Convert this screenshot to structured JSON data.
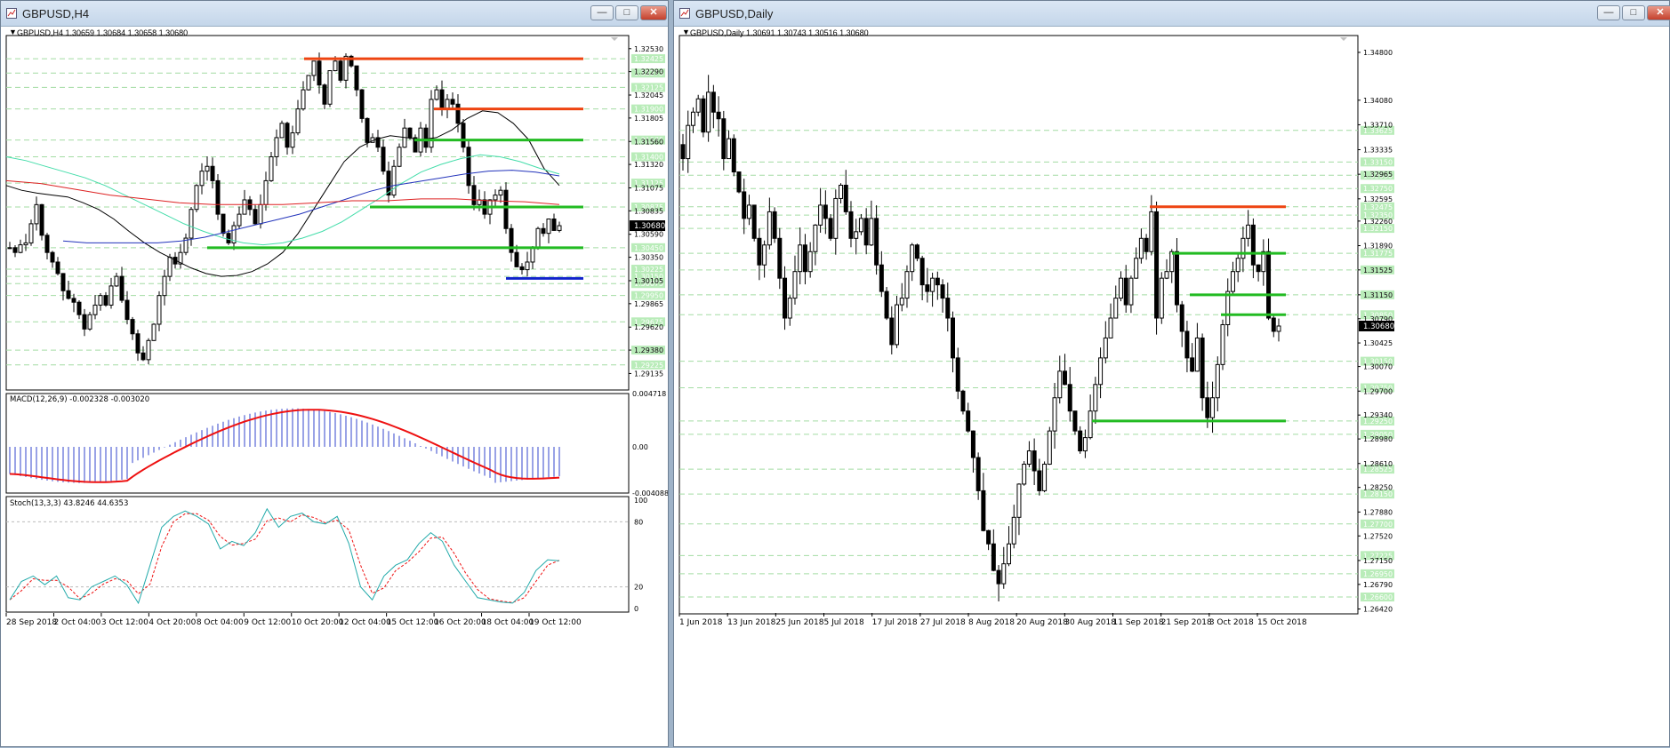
{
  "windows": {
    "h4": {
      "title": "GBPUSD,H4",
      "header": "GBPUSD,H4  1.30659 1.30684 1.30658 1.30680"
    },
    "daily": {
      "title": "GBPUSD,Daily",
      "header": "GBPUSD,Daily  1.30691 1.30743 1.30516 1.30680"
    }
  },
  "window_buttons": {
    "minimize": "—",
    "restore": "□",
    "close": "✕"
  },
  "colors": {
    "bull": "#ffffff",
    "bear": "#000000",
    "support": "#22bb22",
    "resistance": "#ee4411",
    "blue_line": "#1122cc",
    "grid": "#a3dca3",
    "price_box": "#000000",
    "macd_hist": "#3344cc",
    "macd_signal": "#ee1111",
    "stoch_main": "#22aaaa",
    "stoch_signal": "#ee1111",
    "ma_black": "#000000",
    "ma_green": "#44ddaa",
    "ma_blue": "#2233bb",
    "ma_red": "#dd2222"
  },
  "chart_data": [
    {
      "type": "candlestick",
      "title": "GBPUSD,H4",
      "ohlc_readout": [
        1.30659,
        1.30684,
        1.30658,
        1.3068
      ],
      "ylim": [
        1.29,
        1.3263
      ],
      "price_ticks": [
        "1.32530",
        "1.32290",
        "1.32045",
        "1.31805",
        "1.31560",
        "1.31320",
        "1.31075",
        "1.30835",
        "1.30590",
        "1.30350",
        "1.30105",
        "1.29865",
        "1.29620",
        "1.29380",
        "1.29135"
      ],
      "level_labels": [
        "1.32425",
        "1.32275",
        "1.32125",
        "1.31900",
        "1.31575",
        "1.31400",
        "1.31125",
        "1.30875",
        "1.30450",
        "1.30225",
        "1.30150",
        "1.30075",
        "1.29950",
        "1.29675",
        "1.29380",
        "1.29225"
      ],
      "current_price": "1.30680",
      "support_levels": [
        1.30875,
        1.3045,
        1.31575
      ],
      "resistance_levels": [
        1.32425,
        1.319
      ],
      "blue_level": 1.30129,
      "time_labels": [
        "28 Sep 2018",
        "2 Oct 04:00",
        "3 Oct 12:00",
        "4 Oct 20:00",
        "8 Oct 04:00",
        "9 Oct 12:00",
        "10 Oct 20:00",
        "12 Oct 04:00",
        "15 Oct 12:00",
        "16 Oct 20:00",
        "18 Oct 04:00",
        "19 Oct 12:00"
      ],
      "closes": [
        1.3045,
        1.304,
        1.3048,
        1.305,
        1.307,
        1.309,
        1.3058,
        1.304,
        1.303,
        1.3018,
        1.3,
        1.2992,
        1.2988,
        1.2975,
        1.296,
        1.2975,
        1.2985,
        1.2995,
        1.2985,
        1.3005,
        1.3015,
        1.299,
        1.297,
        1.2955,
        1.2935,
        1.2928,
        1.2948,
        1.2965,
        1.2995,
        1.3015,
        1.3035,
        1.3028,
        1.304,
        1.3055,
        1.3085,
        1.311,
        1.3125,
        1.313,
        1.3115,
        1.308,
        1.306,
        1.305,
        1.3068,
        1.308,
        1.3095,
        1.3085,
        1.307,
        1.309,
        1.3115,
        1.314,
        1.316,
        1.3175,
        1.315,
        1.3165,
        1.319,
        1.321,
        1.3225,
        1.324,
        1.3215,
        1.3195,
        1.323,
        1.324,
        1.322,
        1.3245,
        1.3235,
        1.321,
        1.318,
        1.3155,
        1.316,
        1.315,
        1.3125,
        1.31,
        1.313,
        1.315,
        1.317,
        1.316,
        1.3145,
        1.317,
        1.315,
        1.32,
        1.321,
        1.319,
        1.32,
        1.3195,
        1.3175,
        1.315,
        1.311,
        1.309,
        1.3095,
        1.308,
        1.3095,
        1.31,
        1.3105,
        1.3065,
        1.304,
        1.3025,
        1.3022,
        1.303,
        1.3045,
        1.3065,
        1.306,
        1.3075,
        1.3063,
        1.3068
      ],
      "ma_black": [
        1.311,
        1.3105,
        1.3102,
        1.31,
        1.3098,
        1.3092,
        1.3085,
        1.3075,
        1.3062,
        1.305,
        1.304,
        1.3032,
        1.3024,
        1.3018,
        1.3015,
        1.3016,
        1.302,
        1.3028,
        1.304,
        1.306,
        1.3085,
        1.311,
        1.3135,
        1.315,
        1.3158,
        1.3162,
        1.316,
        1.3158,
        1.316,
        1.3168,
        1.318,
        1.3188,
        1.3186,
        1.3175,
        1.3158,
        1.3128,
        1.311
      ],
      "ma_green": [
        1.314,
        1.3136,
        1.313,
        1.3124,
        1.3118,
        1.311,
        1.31,
        1.309,
        1.308,
        1.307,
        1.3062,
        1.3055,
        1.305,
        1.3048,
        1.305,
        1.3055,
        1.3062,
        1.3072,
        1.3085,
        1.3098,
        1.3112,
        1.3124,
        1.3132,
        1.3138,
        1.3142,
        1.314,
        1.3135,
        1.3128,
        1.3122
      ],
      "ma_blue": [
        1.3052,
        1.305,
        1.305,
        1.305,
        1.305,
        1.3052,
        1.3056,
        1.3062,
        1.3068,
        1.3074,
        1.308,
        1.3088,
        1.3096,
        1.3104,
        1.311,
        1.3114,
        1.3118,
        1.3122,
        1.3125,
        1.3126,
        1.3124,
        1.312
      ],
      "ma_red": [
        1.3115,
        1.3112,
        1.3106,
        1.31,
        1.3096,
        1.3092,
        1.309,
        1.309,
        1.309,
        1.3092,
        1.3094,
        1.3094,
        1.3096,
        1.3096,
        1.3094,
        1.3093,
        1.309
      ],
      "macd": {
        "label": "MACD(12,26,9) -0.002328 -0.003020",
        "ticks": [
          "0.004718",
          "0.00",
          "-0.004088"
        ],
        "ylim": [
          -0.004088,
          0.004718
        ]
      },
      "stoch": {
        "label": "Stoch(13,3,3) 43.8246 44.6353",
        "ticks": [
          "100",
          "80",
          "20",
          "0"
        ],
        "ylim": [
          0,
          100
        ]
      }
    },
    {
      "type": "candlestick",
      "title": "GBPUSD,Daily",
      "ohlc_readout": [
        1.30691,
        1.30743,
        1.30516,
        1.3068
      ],
      "ylim": [
        1.264,
        1.35
      ],
      "price_ticks": [
        "1.34800",
        "1.34080",
        "1.33710",
        "1.33335",
        "1.32965",
        "1.32595",
        "1.32260",
        "1.31890",
        "1.31525",
        "1.31150",
        "1.30790",
        "1.30425",
        "1.30070",
        "1.29700",
        "1.29340",
        "1.28980",
        "1.28610",
        "1.28250",
        "1.27880",
        "1.27520",
        "1.27150",
        "1.26790",
        "1.26420"
      ],
      "level_labels": [
        "1.33625",
        "1.33150",
        "1.32950",
        "1.32750",
        "1.32475",
        "1.32350",
        "1.32150",
        "1.31775",
        "1.31525",
        "1.31150",
        "1.30850",
        "1.30150",
        "1.29750",
        "1.29250",
        "1.29050",
        "1.28525",
        "1.28150",
        "1.27700",
        "1.27225",
        "1.26950",
        "1.26600"
      ],
      "current_price": "1.30680",
      "support_levels": [
        1.31775,
        1.3115,
        1.3085,
        1.2925
      ],
      "resistance_levels": [
        1.32475
      ],
      "time_labels": [
        "1 Jun 2018",
        "13 Jun 2018",
        "25 Jun 2018",
        "5 Jul 2018",
        "17 Jul 2018",
        "27 Jul 2018",
        "8 Aug 2018",
        "20 Aug 2018",
        "30 Aug 2018",
        "11 Sep 2018",
        "21 Sep 2018",
        "3 Oct 2018",
        "15 Oct 2018"
      ],
      "closes": [
        1.332,
        1.337,
        1.339,
        1.341,
        1.336,
        1.342,
        1.339,
        1.338,
        1.332,
        1.335,
        1.33,
        1.327,
        1.323,
        1.325,
        1.32,
        1.316,
        1.319,
        1.324,
        1.32,
        1.314,
        1.308,
        1.311,
        1.315,
        1.319,
        1.315,
        1.318,
        1.322,
        1.325,
        1.323,
        1.32,
        1.326,
        1.328,
        1.324,
        1.32,
        1.321,
        1.323,
        1.319,
        1.323,
        1.316,
        1.312,
        1.308,
        1.304,
        1.31,
        1.311,
        1.315,
        1.319,
        1.317,
        1.313,
        1.312,
        1.314,
        1.313,
        1.311,
        1.308,
        1.302,
        1.297,
        1.294,
        1.291,
        1.287,
        1.282,
        1.276,
        1.274,
        1.27,
        1.268,
        1.271,
        1.274,
        1.278,
        1.283,
        1.286,
        1.288,
        1.285,
        1.282,
        1.286,
        1.291,
        1.296,
        1.3,
        1.298,
        1.294,
        1.291,
        1.288,
        1.29,
        1.294,
        1.298,
        1.302,
        1.305,
        1.308,
        1.311,
        1.314,
        1.31,
        1.314,
        1.317,
        1.32,
        1.318,
        1.324,
        1.308,
        1.314,
        1.315,
        1.318,
        1.31,
        1.306,
        1.302,
        1.3,
        1.305,
        1.296,
        1.293,
        1.296,
        1.301,
        1.307,
        1.312,
        1.315,
        1.317,
        1.32,
        1.322,
        1.316,
        1.315,
        1.318,
        1.308,
        1.306,
        1.3068
      ]
    }
  ]
}
